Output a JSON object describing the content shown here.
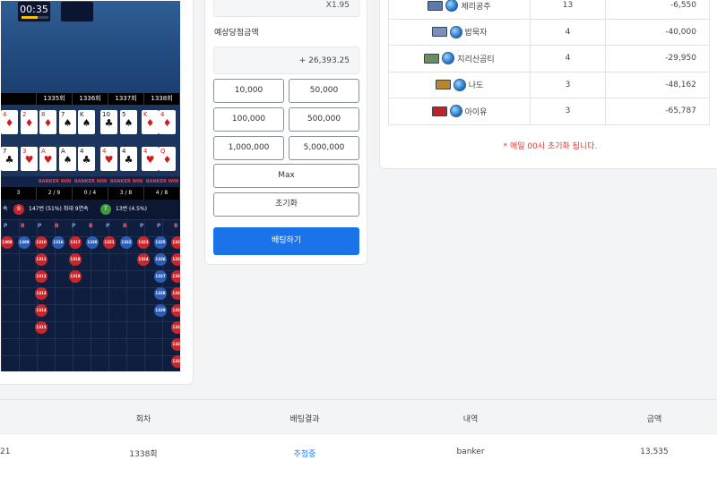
{
  "game": {
    "timer": "00:35",
    "rounds": [
      "",
      "1335회",
      "1336회",
      "1337회",
      "1338회"
    ],
    "results": [
      "",
      "BANKER WIN",
      "BANKER WIN",
      "BANKER WIN",
      "BANKER WIN"
    ],
    "scores": [
      "3",
      "2 / 9",
      "0 / 4",
      "3 / 8",
      "4 / 8"
    ],
    "stats": {
      "prefix": "속",
      "banker_icon": "B",
      "banker_text": "147번 (51%) 최대 9연속",
      "tie_icon": "T",
      "tie_text": "13번 (4.5%)"
    },
    "cards_top": [
      {
        "r": "4",
        "s": "♦",
        "red": true
      },
      {
        "r": "2",
        "s": "♦",
        "red": true
      },
      {
        "r": "8",
        "s": "♦",
        "red": true
      },
      {
        "r": "7",
        "s": "♠",
        "red": false
      },
      {
        "r": "K",
        "s": "♠",
        "red": false
      },
      {
        "r": "10",
        "s": "♣",
        "red": false
      },
      {
        "r": "5",
        "s": "♠",
        "red": false
      },
      {
        "r": "K",
        "s": "♦",
        "red": true
      },
      {
        "r": "4",
        "s": "♦",
        "red": true
      }
    ],
    "cards_bottom": [
      {
        "r": "7",
        "s": "♣",
        "red": false
      },
      {
        "r": "3",
        "s": "♥",
        "red": true
      },
      {
        "r": "A",
        "s": "♥",
        "red": true
      },
      {
        "r": "A",
        "s": "♠",
        "red": false
      },
      {
        "r": "4",
        "s": "♣",
        "red": false
      },
      {
        "r": "4",
        "s": "♥",
        "red": true
      },
      {
        "r": "4",
        "s": "♣",
        "red": false
      },
      {
        "r": "4",
        "s": "♥",
        "red": true
      },
      {
        "r": "Q",
        "s": "♦",
        "red": true
      }
    ],
    "road_headers": [
      "P",
      "B",
      "P",
      "B",
      "P",
      "B",
      "P",
      "B",
      "P",
      "P",
      "B"
    ],
    "beads": [
      {
        "n": "1308",
        "t": "b",
        "col": 0,
        "row": 0
      },
      {
        "n": "1309",
        "t": "p",
        "col": 1,
        "row": 0
      },
      {
        "n": "1310",
        "t": "b",
        "col": 2,
        "row": 0
      },
      {
        "n": "1311",
        "t": "b",
        "col": 2,
        "row": 1
      },
      {
        "n": "1312",
        "t": "b",
        "col": 2,
        "row": 2
      },
      {
        "n": "1313",
        "t": "b",
        "col": 2,
        "row": 3
      },
      {
        "n": "1314",
        "t": "b",
        "col": 2,
        "row": 4
      },
      {
        "n": "1315",
        "t": "b",
        "col": 2,
        "row": 5
      },
      {
        "n": "1316",
        "t": "p",
        "col": 3,
        "row": 0
      },
      {
        "n": "1317",
        "t": "b",
        "col": 4,
        "row": 0
      },
      {
        "n": "1318",
        "t": "b",
        "col": 4,
        "row": 1
      },
      {
        "n": "1319",
        "t": "b",
        "col": 4,
        "row": 2
      },
      {
        "n": "1320",
        "t": "p",
        "col": 5,
        "row": 0
      },
      {
        "n": "1321",
        "t": "b",
        "col": 6,
        "row": 0
      },
      {
        "n": "1322",
        "t": "p",
        "col": 7,
        "row": 0
      },
      {
        "n": "1323",
        "t": "b",
        "col": 8,
        "row": 0
      },
      {
        "n": "1324",
        "t": "b",
        "col": 8,
        "row": 1
      },
      {
        "n": "1325",
        "t": "p",
        "col": 9,
        "row": 0
      },
      {
        "n": "1326",
        "t": "p",
        "col": 9,
        "row": 1
      },
      {
        "n": "1327",
        "t": "p",
        "col": 9,
        "row": 2
      },
      {
        "n": "1328",
        "t": "p",
        "col": 9,
        "row": 3
      },
      {
        "n": "1329",
        "t": "p",
        "col": 9,
        "row": 4
      },
      {
        "n": "1330",
        "t": "b",
        "col": 10,
        "row": 0
      },
      {
        "n": "1331",
        "t": "b",
        "col": 10,
        "row": 1
      },
      {
        "n": "1332",
        "t": "b",
        "col": 10,
        "row": 2
      },
      {
        "n": "1333",
        "t": "b",
        "col": 10,
        "row": 3
      },
      {
        "n": "1334",
        "t": "b",
        "col": 10,
        "row": 4
      },
      {
        "n": "1335",
        "t": "b",
        "col": 10,
        "row": 5
      },
      {
        "n": "1336",
        "t": "b",
        "col": 10,
        "row": 6
      },
      {
        "n": "1337",
        "t": "b",
        "col": 10,
        "row": 7
      }
    ]
  },
  "betting": {
    "odds_value": "X1.95",
    "estimated_label": "예상당첨금액",
    "estimated_value": "+ 26,393.25",
    "amount_buttons": [
      "10,000",
      "50,000",
      "100,000",
      "500,000",
      "1,000,000",
      "5,000,000"
    ],
    "max_label": "Max",
    "reset_label": "초기화",
    "bet_label": "배팅하기"
  },
  "ranking": {
    "rows": [
      {
        "user": "체리공주",
        "count": "13",
        "amount": "-6,550"
      },
      {
        "user": "밥묵자",
        "count": "4",
        "amount": "-40,000"
      },
      {
        "user": "지리산곰티",
        "count": "4",
        "amount": "-29,950"
      },
      {
        "user": "나도",
        "count": "3",
        "amount": "-48,162"
      },
      {
        "user": "아이유",
        "count": "3",
        "amount": "-65,787"
      }
    ],
    "reset_note": "* 매일 00시 초기화 됩니다."
  },
  "history": {
    "headers": [
      "회차",
      "배팅결과",
      "내역",
      "금액"
    ],
    "row": {
      "time_fragment": "21",
      "round": "1338회",
      "result": "추첨중",
      "detail": "banker",
      "amount": "13,535"
    }
  },
  "colors": {
    "accent": "#1a73e8",
    "banker": "#c5272d",
    "player": "#2c5db6",
    "tie": "#3f9b3a",
    "note": "#e53935"
  }
}
